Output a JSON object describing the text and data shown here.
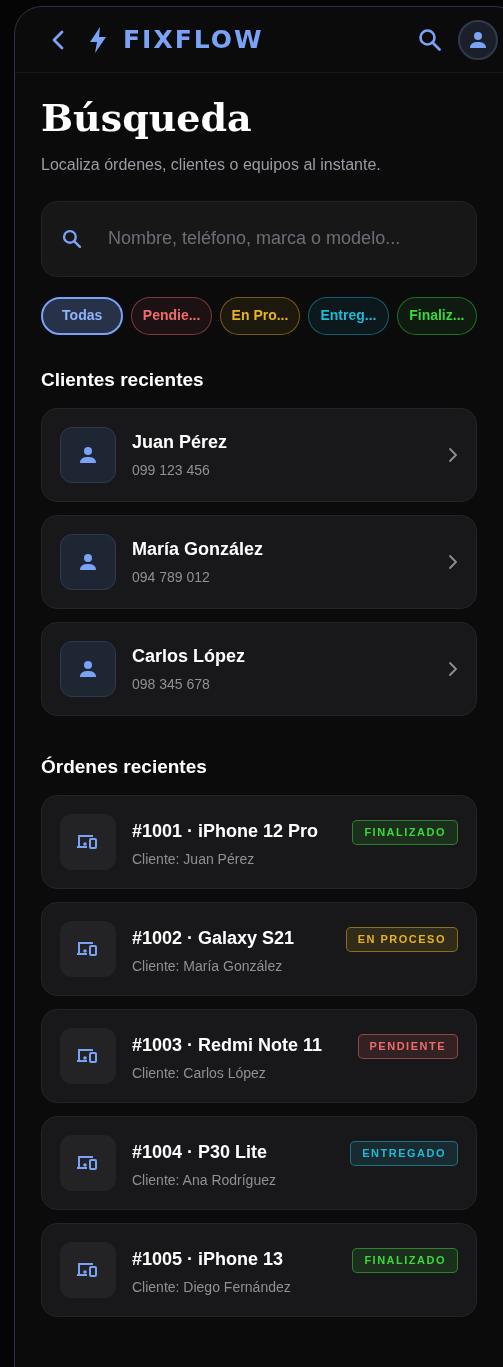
{
  "header": {
    "brand": "FIXFLOW"
  },
  "page": {
    "title": "Búsqueda",
    "subtitle": "Localiza órdenes, clientes o equipos al instante."
  },
  "search": {
    "placeholder": "Nombre, teléfono, marca o modelo..."
  },
  "filters": [
    {
      "label": "Todas",
      "selected": true,
      "color": "#7aa2f7"
    },
    {
      "label": "Pendie...",
      "selected": false,
      "color": "#f06b6b"
    },
    {
      "label": "En Pro...",
      "selected": false,
      "color": "#e6b422"
    },
    {
      "label": "Entreg...",
      "selected": false,
      "color": "#22b8d8"
    },
    {
      "label": "Finaliz...",
      "selected": false,
      "color": "#3ad83a"
    }
  ],
  "clients": {
    "title": "Clientes recientes",
    "items": [
      {
        "name": "Juan Pérez",
        "phone": "099 123 456"
      },
      {
        "name": "María González",
        "phone": "094 789 012"
      },
      {
        "name": "Carlos López",
        "phone": "098 345 678"
      }
    ]
  },
  "orders": {
    "title": "Órdenes recientes",
    "items": [
      {
        "title": "#1001 · iPhone 12 Pro",
        "client": "Cliente: Juan Pérez",
        "status": "FINALIZADO",
        "color": "#3ad83a"
      },
      {
        "title": "#1002 · Galaxy S21",
        "client": "Cliente: María González",
        "status": "EN PROCESO",
        "color": "#e6b422"
      },
      {
        "title": "#1003 · Redmi Note 11",
        "client": "Cliente: Carlos López",
        "status": "PENDIENTE",
        "color": "#f06b6b"
      },
      {
        "title": "#1004 · P30 Lite",
        "client": "Cliente: Ana Rodríguez",
        "status": "ENTREGADO",
        "color": "#22b8d8"
      },
      {
        "title": "#1005 · iPhone 13",
        "client": "Cliente: Diego Fernández",
        "status": "FINALIZADO",
        "color": "#3ad83a"
      }
    ]
  }
}
